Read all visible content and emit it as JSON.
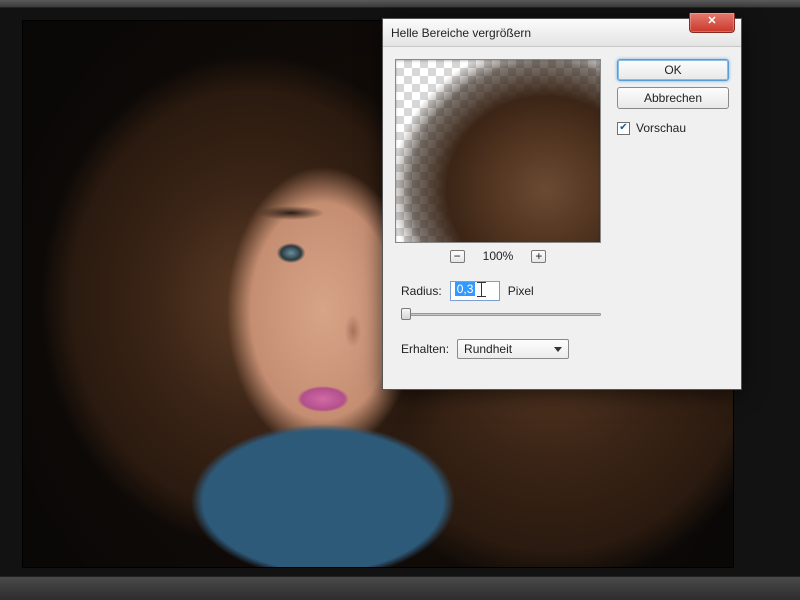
{
  "dialog": {
    "title": "Helle Bereiche vergrößern",
    "ok_label": "OK",
    "cancel_label": "Abbrechen",
    "preview_label": "Vorschau",
    "zoom_level": "100%",
    "radius_label": "Radius:",
    "radius_value": "0,3",
    "radius_unit": "Pixel",
    "erhalten_label": "Erhalten:",
    "erhalten_value": "Rundheit"
  }
}
